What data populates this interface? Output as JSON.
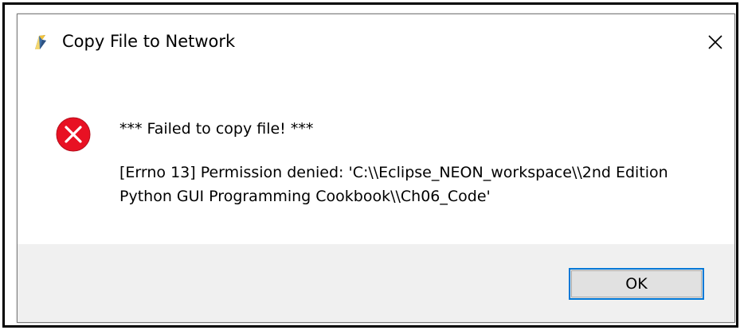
{
  "window": {
    "title": "Copy File to Network",
    "app_icon": "python-feather-icon",
    "close_icon": "close-icon"
  },
  "message": {
    "icon": "error-icon",
    "title": "*** Failed to copy file! ***",
    "detail": "[Errno 13] Permission denied: 'C:\\\\Eclipse_NEON_workspace\\\\2nd Edition Python GUI Programming Cookbook\\\\Ch06_Code'"
  },
  "buttons": {
    "ok_label": "OK"
  },
  "colors": {
    "error_red": "#e81123",
    "focus_blue": "#0078d7",
    "footer_bg": "#f0f0f0"
  }
}
